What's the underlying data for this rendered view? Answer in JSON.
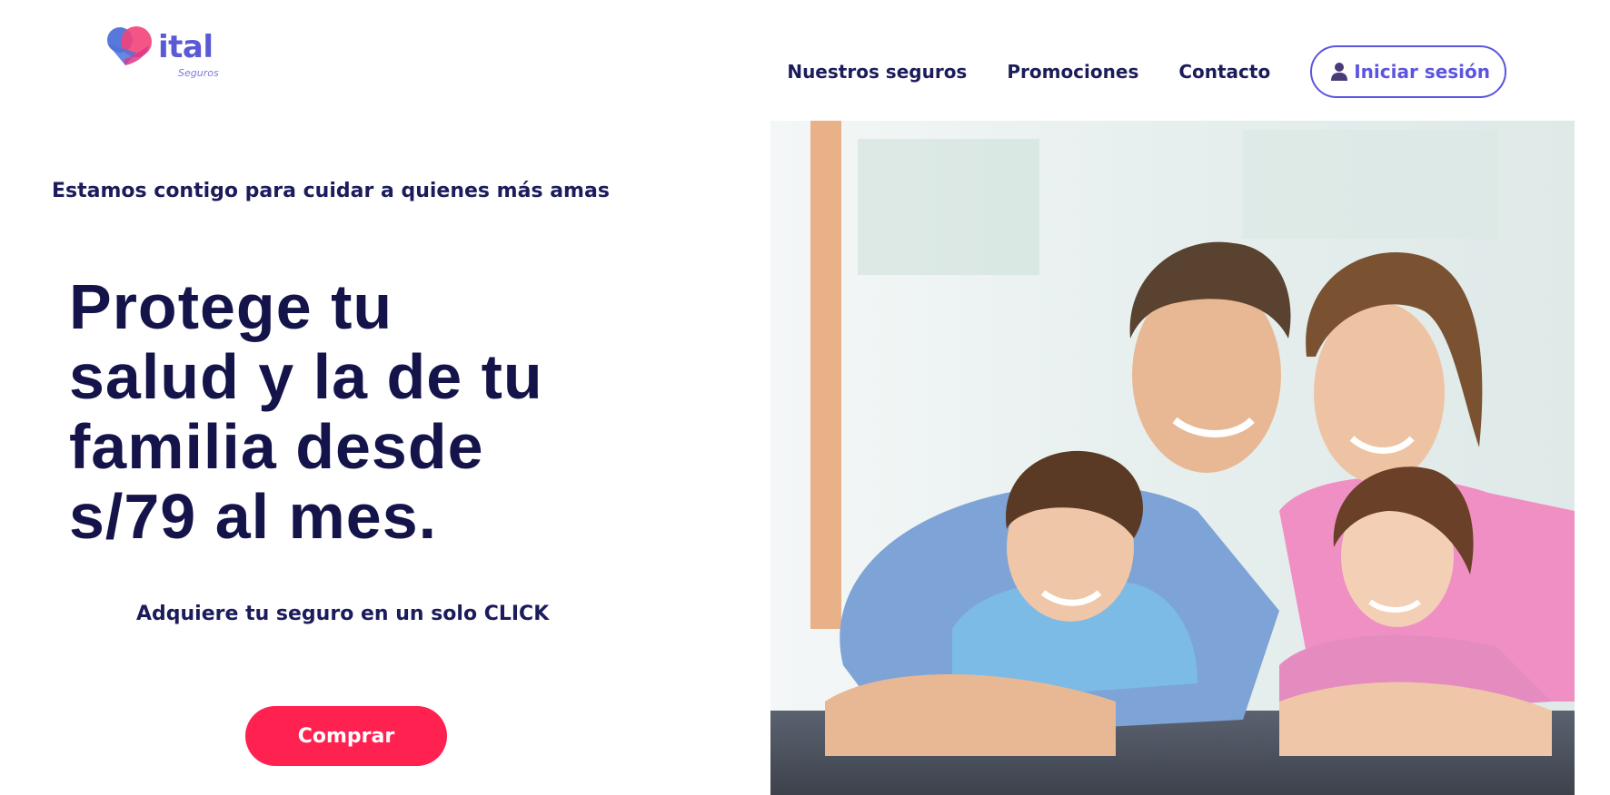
{
  "brand": {
    "name": "ital",
    "subtitle": "Seguros",
    "colors": {
      "heart_blue": "#4f72d9",
      "heart_pink": "#f2427a",
      "word": "#5a5ad6"
    }
  },
  "nav": {
    "links": [
      "Nuestros seguros",
      "Promociones",
      "Contacto"
    ],
    "login": {
      "label": "Iniciar sesión",
      "icon": "user-icon"
    }
  },
  "hero": {
    "tagline": "Estamos contigo para cuidar a quienes más amas",
    "headline_lines": [
      "Protege tu",
      "salud y la de tu",
      "familia desde",
      "s/79 al mes."
    ],
    "subline": "Adquiere tu seguro en un solo CLICK",
    "cta_label": "Comprar",
    "image_description": "family-photo"
  },
  "colors": {
    "text_dark": "#14144a",
    "accent": "#5b55e0",
    "cta": "#ff2250",
    "background": "#ffffff"
  }
}
